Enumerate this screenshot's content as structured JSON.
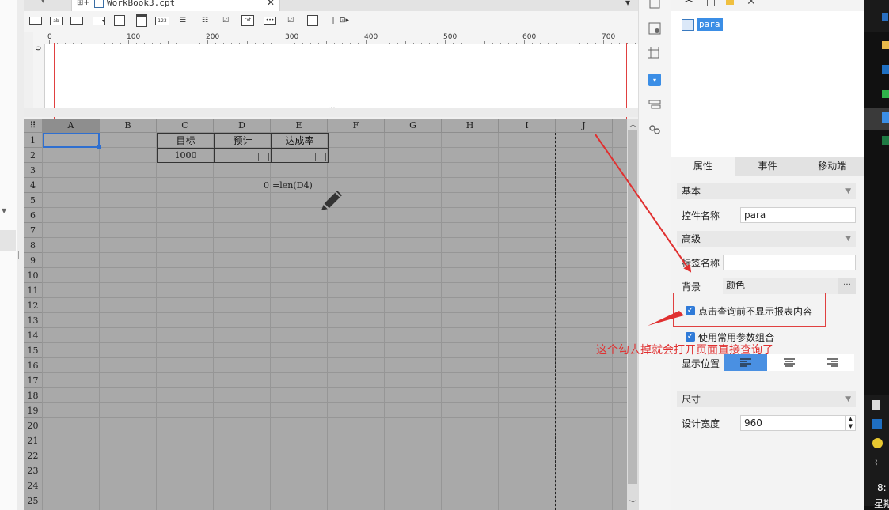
{
  "tab": {
    "filename": "WorkBook3.cpt"
  },
  "ruler": {
    "h_ticks": [
      "0",
      "100",
      "200",
      "300",
      "400",
      "500",
      "600",
      "700"
    ],
    "v_tick": "0"
  },
  "grid": {
    "columns": [
      "A",
      "B",
      "C",
      "D",
      "E",
      "F",
      "G",
      "H",
      "I",
      "J"
    ],
    "rows": [
      "1",
      "2",
      "3",
      "4",
      "5",
      "6",
      "7",
      "8",
      "9",
      "10",
      "11",
      "12",
      "13",
      "14",
      "15",
      "16",
      "17",
      "18",
      "19",
      "20",
      "21",
      "22",
      "23",
      "24",
      "25"
    ],
    "cells": {
      "c1": "目标",
      "d1": "预计",
      "e1": "达成率",
      "c2": "1000",
      "d4": "0",
      "e4": "=len(D4)"
    }
  },
  "widget_tree": {
    "item_label": "para"
  },
  "panel": {
    "tabs": [
      "属性",
      "事件",
      "移动端"
    ],
    "section_basic": "基本",
    "widget_name_label": "控件名称",
    "widget_name_value": "para",
    "section_advanced": "高级",
    "tag_name_label": "标签名称",
    "tag_name_value": "",
    "background_label": "背景",
    "background_value": "颜色",
    "background_more": "···",
    "checkbox1_label": "点击查询前不显示报表内容",
    "checkbox2_label": "使用常用参数组合",
    "display_position_label": "显示位置",
    "section_size": "尺寸",
    "design_width_label": "设计宽度",
    "design_width_value": "960"
  },
  "annotation": {
    "text": "这个勾去掉就会打开页面直接查询了"
  },
  "taskbar": {
    "clock_partial": "8:",
    "day_partial": "星期"
  },
  "colors": {
    "selection": "#2f6fd0",
    "annotation_red": "#e03030",
    "checkbox_blue": "#2f7ad8",
    "align_active": "#4a90e2"
  }
}
